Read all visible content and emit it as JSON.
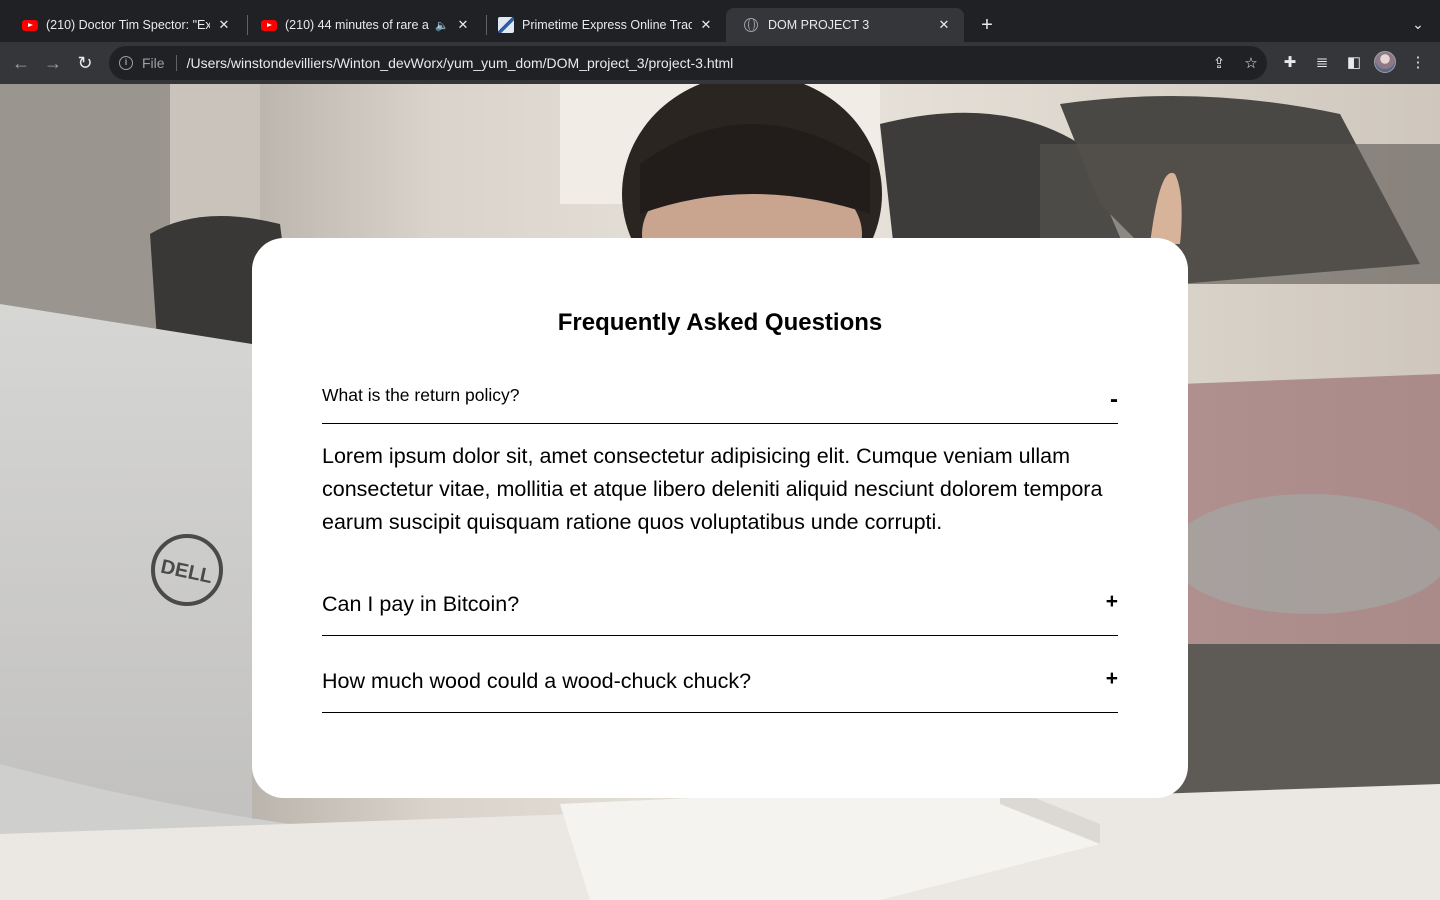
{
  "browser": {
    "tabs": [
      {
        "title": "(210) Doctor Tim Spector: \"Ex",
        "favicon": "youtube-icon",
        "active": false
      },
      {
        "title": "(210) 44 minutes of rare a",
        "favicon": "youtube-icon",
        "active": false,
        "audio": true
      },
      {
        "title": "Primetime Express Online Trac",
        "favicon": "primetime-icon",
        "active": false
      },
      {
        "title": "DOM PROJECT 3",
        "favicon": "globe-icon",
        "active": true
      }
    ],
    "new_tab": "+",
    "file_label": "File",
    "url": "/Users/winstondevilliers/Winton_devWorx/yum_yum_dom/DOM_project_3/project-3.html"
  },
  "faq": {
    "title": "Frequently Asked Questions",
    "items": [
      {
        "question": "What is the return policy?",
        "toggle": "-",
        "expanded": true,
        "answer": "Lorem ipsum dolor sit, amet consectetur adipisicing elit. Cumque veniam ullam consectetur vitae, mollitia et atque libero deleniti aliquid nesciunt dolorem tempora earum suscipit quisquam ratione quos voluptatibus unde corrupti."
      },
      {
        "question": "Can I pay in Bitcoin?",
        "toggle": "+",
        "expanded": false
      },
      {
        "question": "How much wood could a wood-chuck chuck?",
        "toggle": "+",
        "expanded": false
      }
    ]
  },
  "colors": {
    "chrome_dark": "#202124",
    "chrome_toolbar": "#35363a",
    "card": "#ffffff",
    "text": "#000000"
  }
}
